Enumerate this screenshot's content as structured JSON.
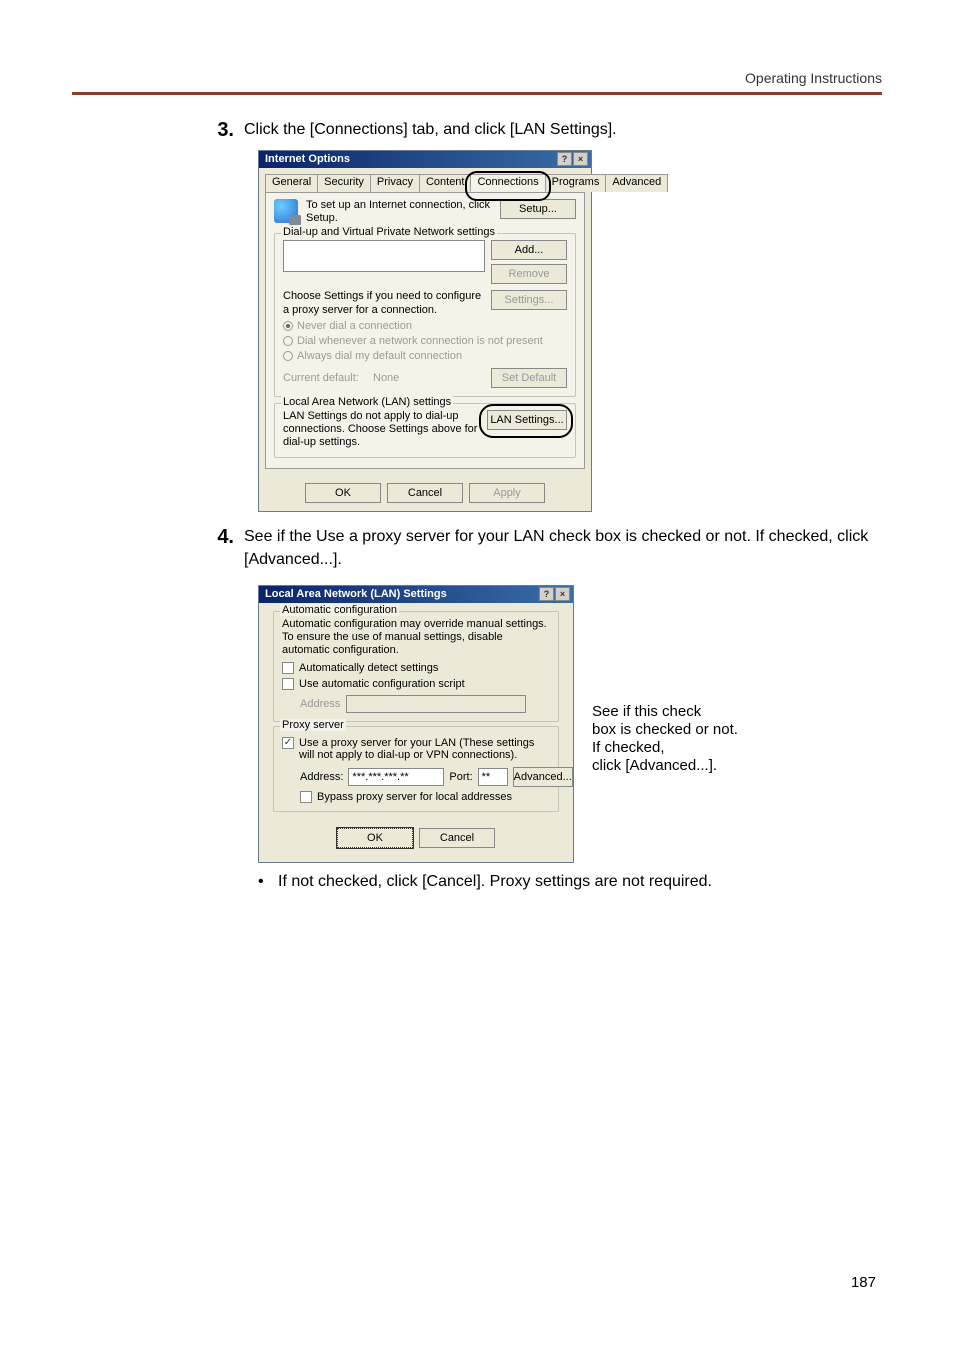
{
  "header": {
    "operating": "Operating Instructions"
  },
  "steps": {
    "s3num": "3.",
    "s3text": "Click the [Connections] tab, and click [LAN Settings].",
    "s4num": "4.",
    "s4text": "See if the Use a proxy server for your LAN check box is checked or not. If checked, click [Advanced...]."
  },
  "dialog1": {
    "title": "Internet Options",
    "help": "?",
    "close": "×",
    "tabs": {
      "general": "General",
      "security": "Security",
      "privacy": "Privacy",
      "content": "Content",
      "connections": "Connections",
      "programs": "Programs",
      "advanced": "Advanced"
    },
    "setup_text": "To set up an Internet connection, click Setup.",
    "setup_btn": "Setup...",
    "dial_group": "Dial-up and Virtual Private Network settings",
    "add_btn": "Add...",
    "remove_btn": "Remove",
    "choose_text": "Choose Settings if you need to configure a proxy server for a connection.",
    "settings_btn": "Settings...",
    "radio1": "Never dial a connection",
    "radio2": "Dial whenever a network connection is not present",
    "radio3": "Always dial my default connection",
    "current_lbl": "Current default:",
    "current_val": "None",
    "set_default_btn": "Set Default",
    "lan_group": "Local Area Network (LAN) settings",
    "lan_text": "LAN Settings do not apply to dial-up connections. Choose Settings above for dial-up settings.",
    "lan_btn": "LAN Settings...",
    "ok": "OK",
    "cancel": "Cancel",
    "apply": "Apply"
  },
  "dialog2": {
    "title": "Local Area Network (LAN) Settings",
    "help": "?",
    "close": "×",
    "auto_group": "Automatic configuration",
    "auto_text": "Automatic configuration may override manual settings. To ensure the use of manual settings, disable automatic configuration.",
    "auto_detect": "Automatically detect settings",
    "use_script": "Use automatic configuration script",
    "address_lbl": "Address",
    "proxy_group": "Proxy server",
    "use_proxy": "Use a proxy server for your LAN (These settings will not apply to dial-up or VPN connections).",
    "addr2_lbl": "Address:",
    "addr2_val": "***.***.***.**",
    "port_lbl": "Port:",
    "port_val": "**",
    "advanced_btn": "Advanced...",
    "bypass": "Bypass proxy server for local addresses",
    "ok": "OK",
    "cancel": "Cancel"
  },
  "callout": {
    "l1": "See if this check",
    "l2": "box is checked or not.",
    "l3": "If checked,",
    "l4": "click [Advanced...]."
  },
  "bullet": {
    "dot": "•",
    "text": "If not checked, click [Cancel]. Proxy settings are not required."
  },
  "page_number": "187"
}
